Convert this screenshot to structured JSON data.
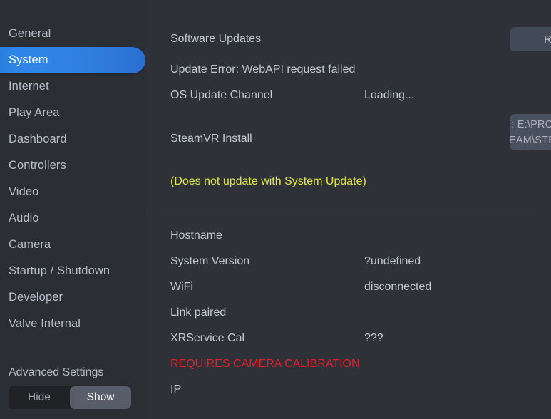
{
  "sidebar": {
    "items": [
      {
        "label": "General",
        "active": false
      },
      {
        "label": "System",
        "active": true
      },
      {
        "label": "Internet",
        "active": false
      },
      {
        "label": "Play Area",
        "active": false
      },
      {
        "label": "Dashboard",
        "active": false
      },
      {
        "label": "Controllers",
        "active": false
      },
      {
        "label": "Video",
        "active": false
      },
      {
        "label": "Audio",
        "active": false
      },
      {
        "label": "Camera",
        "active": false
      },
      {
        "label": "Startup / Shutdown",
        "active": false
      },
      {
        "label": "Developer",
        "active": false
      },
      {
        "label": "Valve Internal",
        "active": false
      }
    ],
    "advanced": {
      "label": "Advanced Settings",
      "hide_label": "Hide",
      "show_label": "Show",
      "selected": "Show"
    }
  },
  "main": {
    "software_updates_label": "Software Updates",
    "retry_install_label": "RETRY INSTALL",
    "update_error_text": "Update Error: WebAPI request failed",
    "os_update_channel_label": "OS Update Channel",
    "os_update_channel_value": "Loading...",
    "steamvr_install_label": "SteamVR Install",
    "steamvr_install_path_line1": "M: E:\\PROGRAM",
    "steamvr_install_path_line2": "TEAM\\STEAMAPPS\\COMMON\\STEA",
    "no_system_update_note": "(Does not update with System Update)",
    "hostname_label": "Hostname",
    "hostname_value": "",
    "system_version_label": "System Version",
    "system_version_value": "?undefined",
    "wifi_label": "WiFi",
    "wifi_value": "disconnected",
    "link_paired_label": "Link paired",
    "link_paired_value": "",
    "xrservice_cal_label": "XRService Cal",
    "xrservice_cal_value": "???",
    "camera_calibration_warning": "REQUIRES CAMERA CALIBRATION",
    "ip_label": "IP",
    "ip_value": ""
  },
  "colors": {
    "accent_blue": "#2f82e4",
    "warning_yellow": "#e4e640",
    "error_red": "#e01f2c",
    "sidebar_bg": "#2b2e33",
    "main_bg": "#2e3238",
    "text_primary": "#c2c8d0"
  }
}
